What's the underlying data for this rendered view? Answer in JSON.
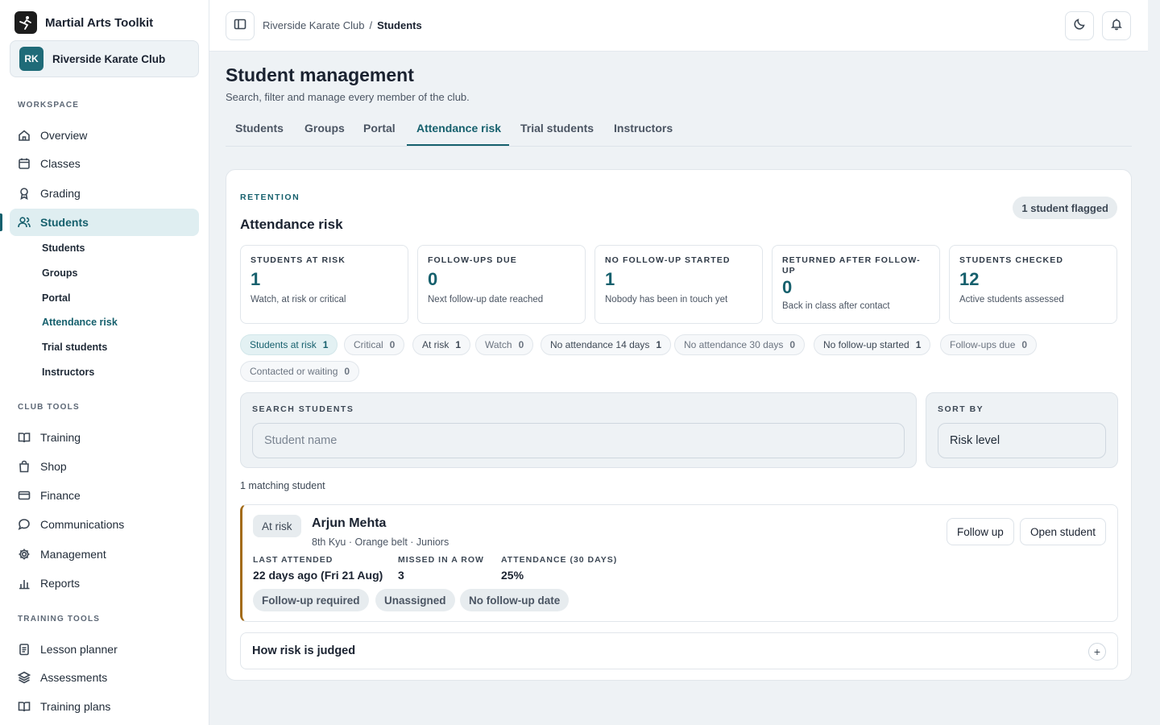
{
  "app": {
    "name": "Martial Arts Toolkit"
  },
  "club": {
    "initials": "RK",
    "name": "Riverside Karate Club"
  },
  "sidebar": {
    "workspace_label": "WORKSPACE",
    "workspace": [
      {
        "label": "Overview",
        "icon": "home-icon"
      },
      {
        "label": "Classes",
        "icon": "calendar-icon"
      },
      {
        "label": "Grading",
        "icon": "award-icon"
      },
      {
        "label": "Students",
        "icon": "users-icon"
      }
    ],
    "student_sub": [
      "Students",
      "Groups",
      "Portal",
      "Attendance risk",
      "Trial students",
      "Instructors"
    ],
    "club_tools_label": "CLUB TOOLS",
    "club_tools": [
      {
        "label": "Training",
        "icon": "book-icon"
      },
      {
        "label": "Shop",
        "icon": "bag-icon"
      },
      {
        "label": "Finance",
        "icon": "card-icon"
      },
      {
        "label": "Communications",
        "icon": "chat-icon"
      },
      {
        "label": "Management",
        "icon": "gear-icon"
      },
      {
        "label": "Reports",
        "icon": "bar-chart-icon"
      }
    ],
    "training_tools_label": "TRAINING TOOLS",
    "training_tools": [
      {
        "label": "Lesson planner",
        "icon": "clipboard-icon"
      },
      {
        "label": "Assessments",
        "icon": "layers-icon"
      },
      {
        "label": "Training plans",
        "icon": "book-icon"
      }
    ]
  },
  "breadcrumb": {
    "parent": "Riverside Karate Club",
    "separator": "/",
    "current": "Students"
  },
  "page": {
    "title": "Student management",
    "subtitle": "Search, filter and manage every member of the club."
  },
  "tabs": [
    "Students",
    "Groups",
    "Portal",
    "Attendance risk",
    "Trial students",
    "Instructors"
  ],
  "retention": {
    "eyebrow": "RETENTION",
    "title": "Attendance risk",
    "flag": "1 student flagged",
    "stats": [
      {
        "label": "STUDENTS AT RISK",
        "value": "1",
        "note": "Watch, at risk or critical"
      },
      {
        "label": "FOLLOW-UPS DUE",
        "value": "0",
        "note": "Next follow-up date reached"
      },
      {
        "label": "NO FOLLOW-UP STARTED",
        "value": "1",
        "note": "Nobody has been in touch yet"
      },
      {
        "label": "RETURNED AFTER FOLLOW-UP",
        "value": "0",
        "note": "Back in class after contact"
      },
      {
        "label": "STUDENTS CHECKED",
        "value": "12",
        "note": "Active students assessed"
      }
    ],
    "filters": [
      {
        "label": "Students at risk",
        "count": "1"
      },
      {
        "label": "Critical",
        "count": "0"
      },
      {
        "label": "At risk",
        "count": "1"
      },
      {
        "label": "Watch",
        "count": "0"
      },
      {
        "label": "No attendance 14 days",
        "count": "1"
      },
      {
        "label": "No attendance 30 days",
        "count": "0"
      },
      {
        "label": "No follow-up started",
        "count": "1"
      },
      {
        "label": "Follow-ups due",
        "count": "0"
      },
      {
        "label": "Contacted or waiting",
        "count": "0"
      }
    ],
    "search": {
      "label": "SEARCH STUDENTS",
      "placeholder": "Student name"
    },
    "sort": {
      "label": "SORT BY",
      "value": "Risk level"
    },
    "match_count": "1 matching student",
    "student": {
      "risk": "At risk",
      "name": "Arjun Mehta",
      "meta": "8th Kyu · Orange belt · Juniors",
      "follow_up_label": "Follow up",
      "open_label": "Open student",
      "metrics": [
        {
          "label": "LAST ATTENDED",
          "value": "22 days ago (Fri 21 Aug)"
        },
        {
          "label": "MISSED IN A ROW",
          "value": "3"
        },
        {
          "label": "ATTENDANCE (30 DAYS)",
          "value": "25%"
        }
      ],
      "tags": [
        "Follow-up required",
        "Unassigned",
        "No follow-up date"
      ]
    },
    "accordion": {
      "title": "How risk is judged",
      "toggle": "+"
    }
  }
}
